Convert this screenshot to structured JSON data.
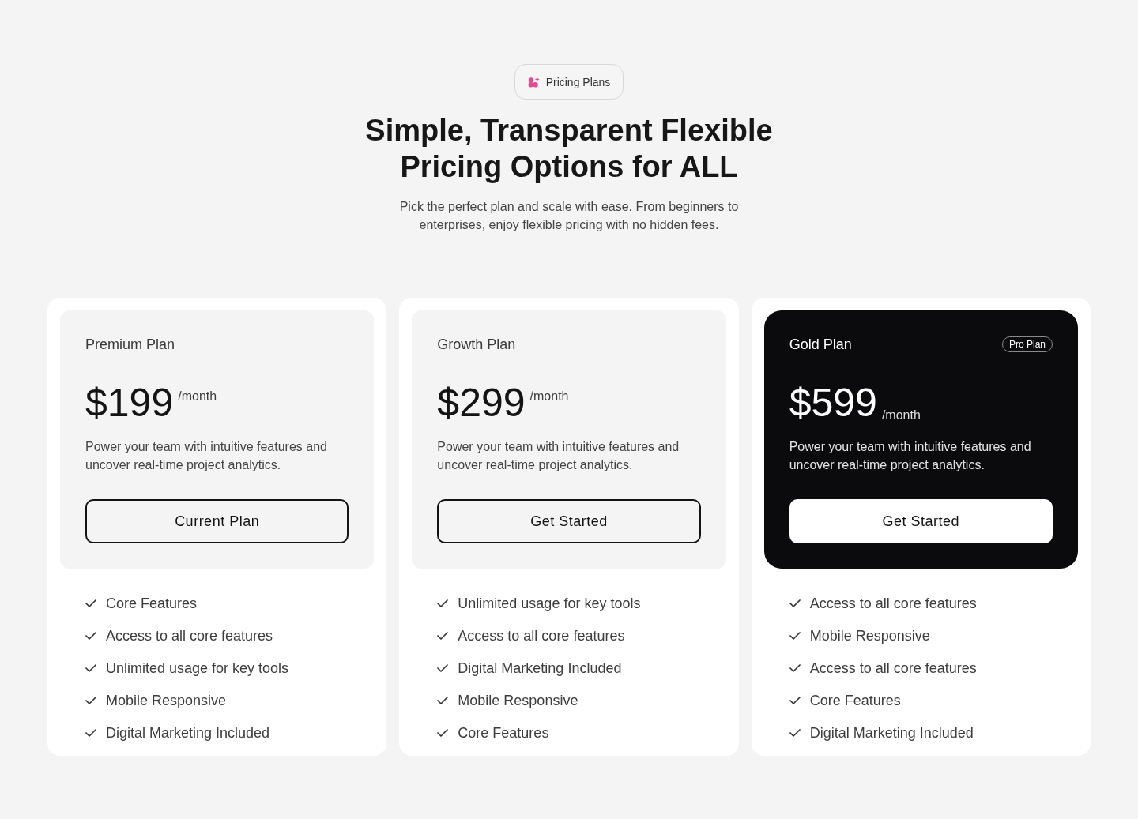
{
  "badge": {
    "label": "Pricing Plans"
  },
  "heading": "Simple, Transparent Flexible Pricing Options for ALL",
  "subtitle": "Pick the perfect plan and scale with ease. From beginners to enterprises, enjoy flexible pricing with no hidden fees.",
  "plans": [
    {
      "name": "Premium Plan",
      "price": "$199",
      "period": "/month",
      "description": "Power your team with intuitive features and uncover real-time project analytics.",
      "button": "Current Plan",
      "highlighted": false,
      "features": [
        "Core Features",
        "Access to all core features",
        "Unlimited usage for key tools",
        "Mobile Responsive",
        "Digital Marketing Included"
      ]
    },
    {
      "name": "Growth Plan",
      "price": "$299",
      "period": "/month",
      "description": "Power your team with intuitive features and uncover real-time project analytics.",
      "button": "Get Started",
      "highlighted": false,
      "features": [
        "Unlimited usage for key tools",
        "Access to all core features",
        "Digital Marketing Included",
        "Mobile Responsive",
        "Core Features"
      ]
    },
    {
      "name": "Gold Plan",
      "tag": "Pro Plan",
      "price": "$599",
      "period": "/month",
      "description": "Power your team with intuitive features and uncover real-time project analytics.",
      "button": "Get Started",
      "highlighted": true,
      "features": [
        "Access to all core features",
        "Mobile Responsive",
        "Access to all core features",
        "Core Features",
        "Digital Marketing Included"
      ]
    }
  ]
}
